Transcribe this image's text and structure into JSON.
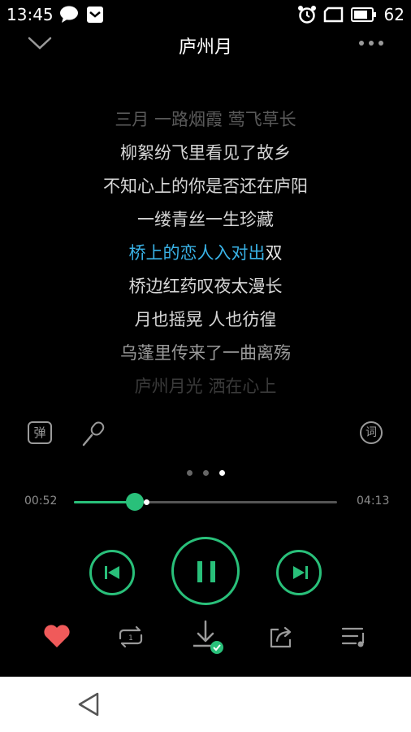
{
  "status_bar": {
    "time": "13:45",
    "battery": "62"
  },
  "header": {
    "title": "庐州月"
  },
  "lyrics": {
    "lines": [
      "三月 一路烟霞 莺飞草长",
      "柳絮纷飞里看见了故乡",
      "不知心上的你是否还在庐阳",
      "一缕青丝一生珍藏",
      "",
      "桥边红药叹夜太漫长",
      "月也摇晃 人也彷徨",
      "乌蓬里传来了一曲离殇",
      "庐州月光 洒在心上"
    ],
    "current_sung": "桥上的恋人入对出",
    "current_rest": "双"
  },
  "tools": {
    "danmu_label": "弹",
    "lyrics_label": "词"
  },
  "pager": {
    "count": 3,
    "active": 2
  },
  "progress": {
    "elapsed": "00:52",
    "total": "04:13",
    "fraction": 0.23,
    "buffered_fraction": 0.275
  },
  "colors": {
    "accent": "#29c07a",
    "highlight": "#39b2e6",
    "favorite": "#f05a5a"
  },
  "icons": {
    "minimize": "chevron-down-icon",
    "more": "more-dots-icon",
    "previous": "skip-previous-icon",
    "pause": "pause-icon",
    "next": "skip-next-icon",
    "favorite": "heart-icon",
    "loop": "repeat-icon",
    "download": "download-done-icon",
    "share": "share-icon",
    "playlist": "playlist-icon",
    "back": "back-triangle-icon"
  }
}
